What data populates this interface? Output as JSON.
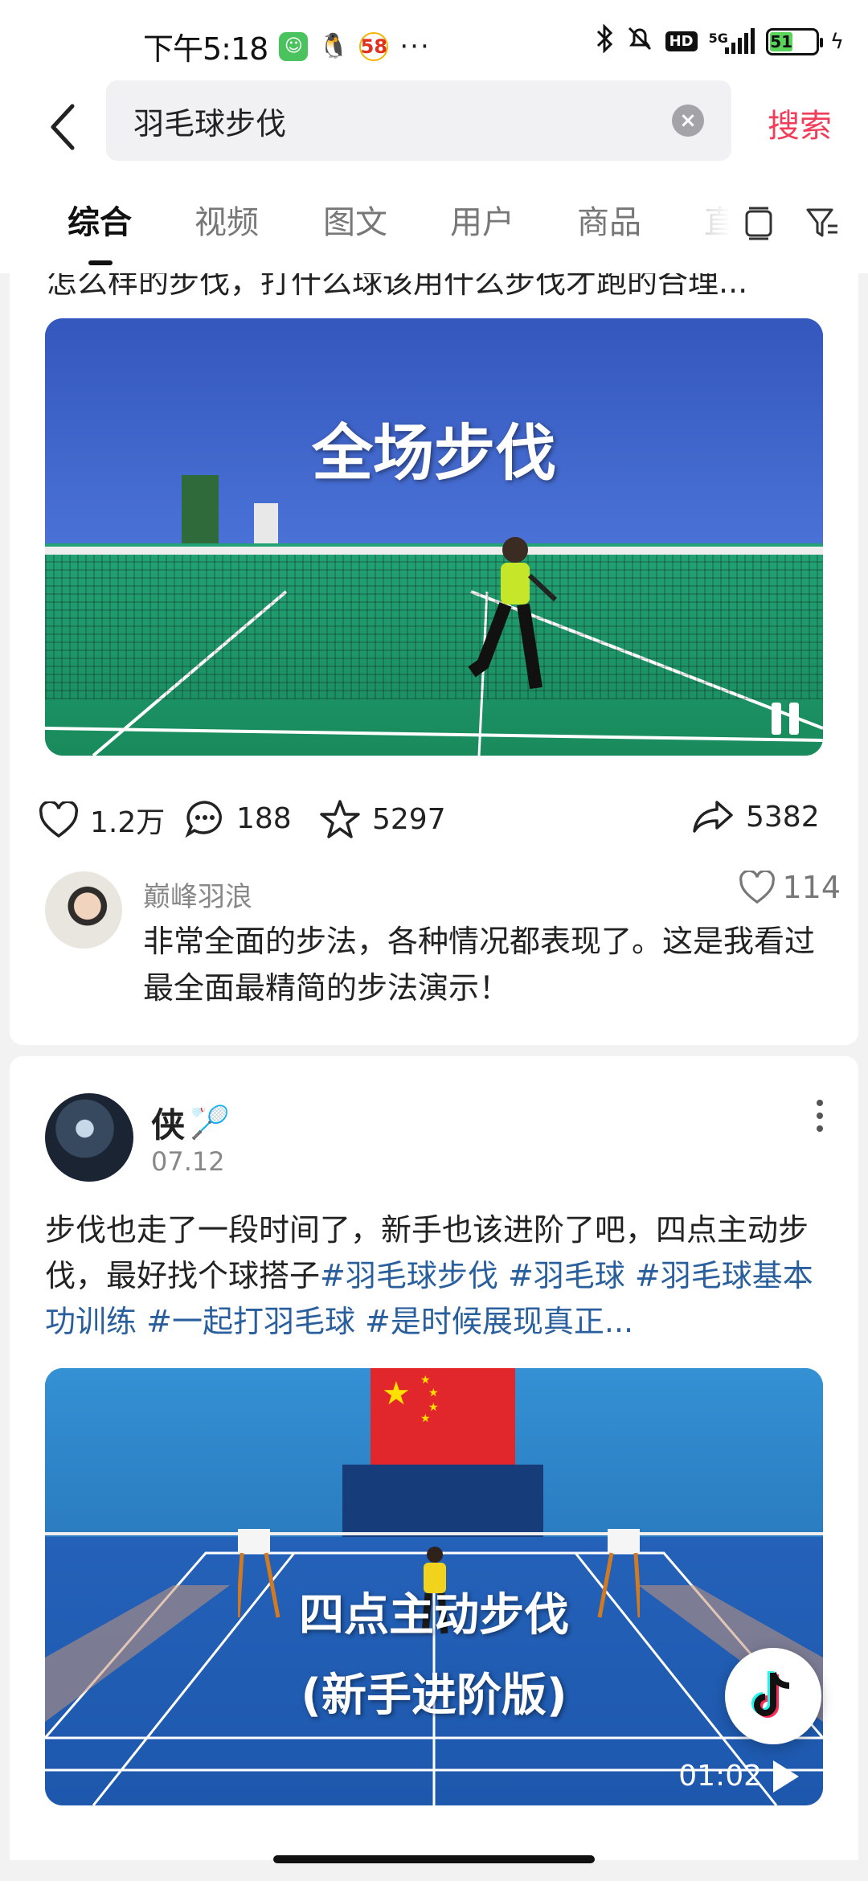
{
  "status_bar": {
    "time": "下午5:18",
    "app_icons": [
      "wechat-icon",
      "qq-icon",
      "58-icon"
    ],
    "more": "···",
    "hd": "HD",
    "network": "5G",
    "battery": "51"
  },
  "search": {
    "query": "羽毛球步伐",
    "clear_icon": "×",
    "submit_label": "搜索"
  },
  "tabs": [
    "综合",
    "视频",
    "图文",
    "用户",
    "商品",
    "直"
  ],
  "active_tab": "综合",
  "post1": {
    "truncated_text": "怎么样的步伐，打什么球该用什么步伐才跑的合理...",
    "video_title": "全场步伐",
    "likes": "1.2万",
    "comments": "188",
    "favorites": "5297",
    "shares": "5382",
    "top_comment": {
      "author": "巅峰羽浪",
      "likes": "114",
      "text": "非常全面的步法，各种情况都表现了。这是我看过最全面最精简的步法演示！"
    }
  },
  "post2": {
    "author": "侠",
    "author_emoji": "🏸",
    "date": "07.12",
    "text": "步伐也走了一段时间了，新手也该进阶了吧，四点主动步伐，最好找个球搭子",
    "hashtags": [
      "#羽毛球步伐",
      "#羽毛球",
      "#羽毛球基本功训练",
      "#一起打羽毛球",
      "#是时候展现真正..."
    ],
    "video_title_line1": "四点主动步伐",
    "video_title_line2": "(新手进阶版)",
    "duration": "01:02"
  }
}
